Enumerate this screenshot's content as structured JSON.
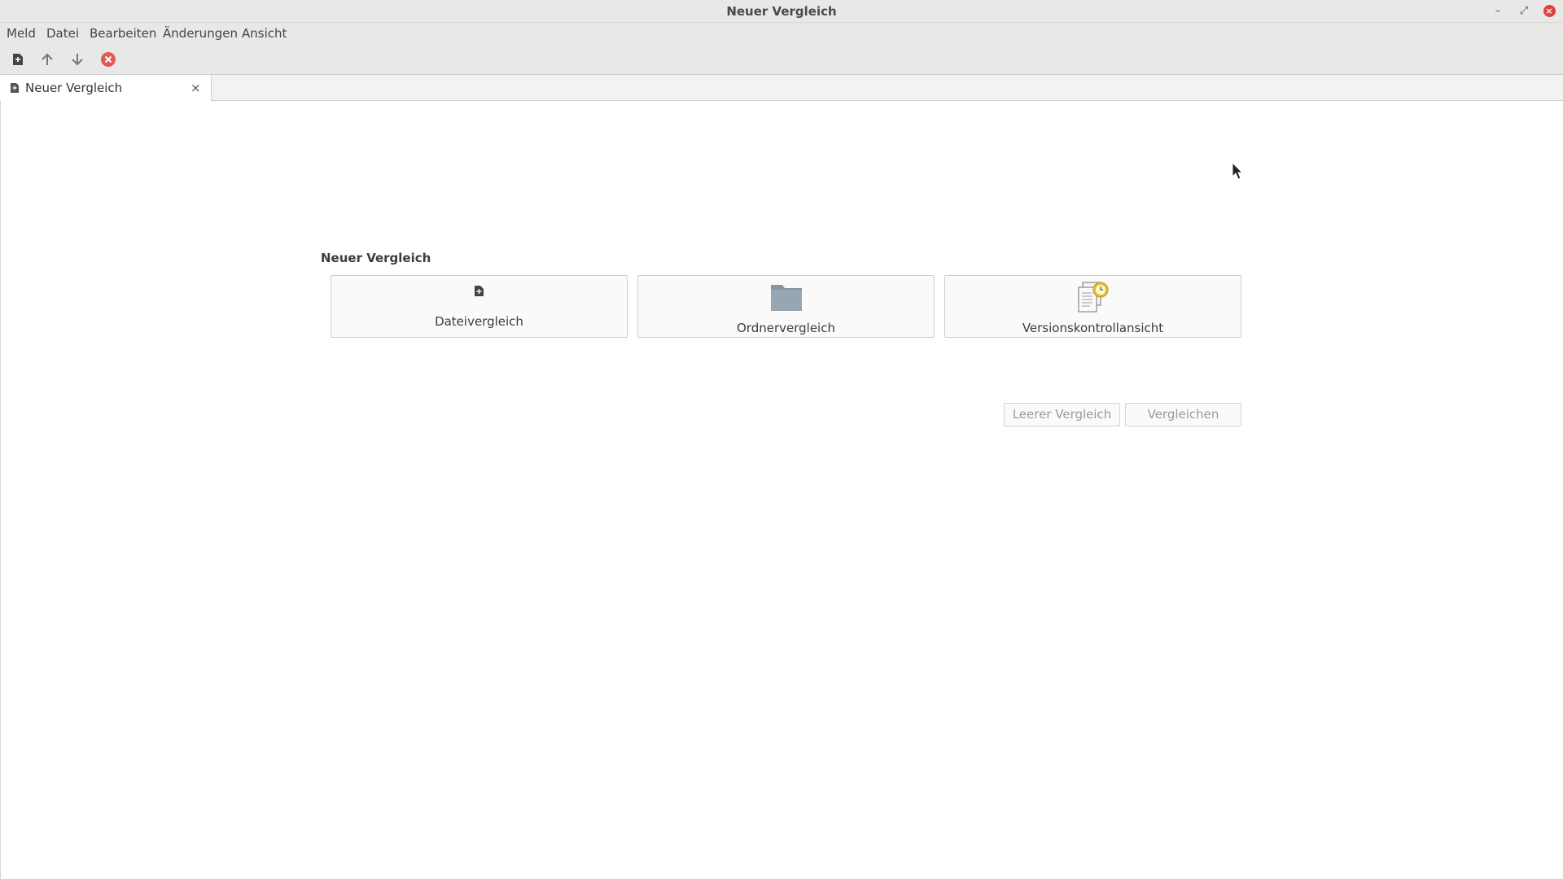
{
  "window": {
    "title": "Neuer Vergleich"
  },
  "menubar": {
    "items": [
      "Meld",
      "Datei",
      "Bearbeiten",
      "Änderungen",
      "Ansicht"
    ]
  },
  "toolbar": {
    "buttons": [
      "new-comparison-icon",
      "arrow-up-icon",
      "arrow-down-icon",
      "stop-icon"
    ]
  },
  "tabs": [
    {
      "label": "Neuer Vergleich",
      "close": "×"
    }
  ],
  "main": {
    "heading": "Neuer Vergleich",
    "options": [
      {
        "label": "Dateivergleich",
        "icon": "file-icon"
      },
      {
        "label": "Ordnervergleich",
        "icon": "folder-icon"
      },
      {
        "label": "Versionskontrollansicht",
        "icon": "version-control-icon"
      }
    ],
    "buttons": {
      "blank": "Leerer Vergleich",
      "compare": "Vergleichen"
    }
  },
  "colors": {
    "folder": "#8796a1",
    "close": "#e0413c",
    "vc_badge": "#e3c22a"
  }
}
